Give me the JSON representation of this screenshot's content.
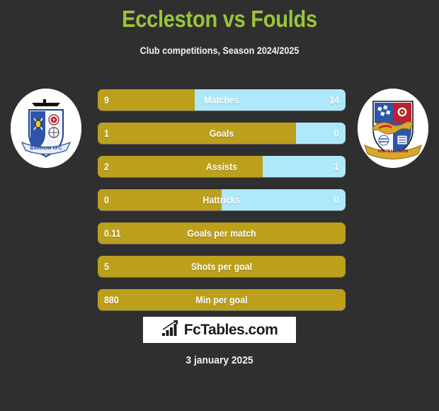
{
  "header": {
    "title": "Eccleston vs Foulds",
    "subtitle": "Club competitions, Season 2024/2025",
    "title_color": "#9ac43c"
  },
  "colors": {
    "background": "#2f2f2f",
    "bar_left": "#bca01b",
    "bar_right": "#aee9fb",
    "text": "#ffffff"
  },
  "crests": {
    "left": {
      "name": "barrow-afc-crest",
      "club": "BARROW AFC"
    },
    "right": {
      "name": "right-team-crest",
      "club": ""
    }
  },
  "stats": [
    {
      "label": "Matches",
      "left": "9",
      "right": "14",
      "left_pct": 39.1,
      "dual": true
    },
    {
      "label": "Goals",
      "left": "1",
      "right": "0",
      "left_pct": 80.0,
      "dual": true
    },
    {
      "label": "Assists",
      "left": "2",
      "right": "1",
      "left_pct": 66.7,
      "dual": true
    },
    {
      "label": "Hattricks",
      "left": "0",
      "right": "0",
      "left_pct": 50.0,
      "dual": true
    },
    {
      "label": "Goals per match",
      "left": "0.11",
      "right": "",
      "left_pct": 100,
      "dual": false
    },
    {
      "label": "Shots per goal",
      "left": "5",
      "right": "",
      "left_pct": 100,
      "dual": false
    },
    {
      "label": "Min per goal",
      "left": "880",
      "right": "",
      "left_pct": 100,
      "dual": false
    }
  ],
  "footer": {
    "logo_text": "FcTables.com",
    "logo_icon": "bar-chart-up-icon",
    "date": "3 january 2025"
  }
}
